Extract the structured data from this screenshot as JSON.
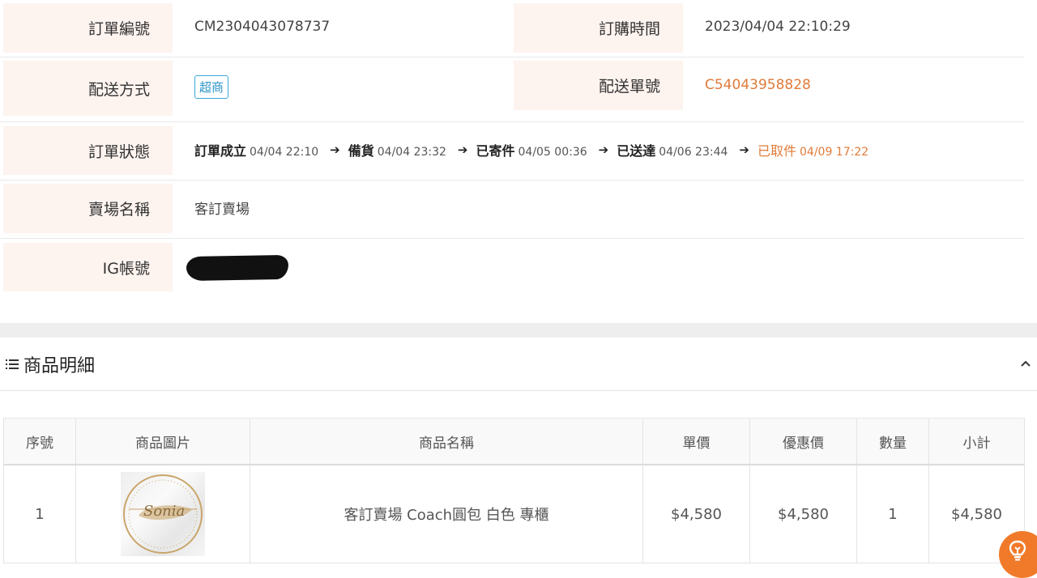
{
  "order": {
    "number_label": "訂單編號",
    "number": "CM2304043078737",
    "time_label": "訂購時間",
    "time": "2023/04/04 22:10:29",
    "shipping_label": "配送方式",
    "shipping_method": "超商",
    "tracking_label": "配送單號",
    "tracking_number": "C54043958828",
    "status_label": "訂單狀態",
    "statuses": [
      {
        "name": "訂單成立",
        "time": "04/04 22:10"
      },
      {
        "name": "備貨",
        "time": "04/04 23:32"
      },
      {
        "name": "已寄件",
        "time": "04/05 00:36"
      },
      {
        "name": "已送達",
        "time": "04/06 23:44"
      },
      {
        "name": "已取件",
        "time": "04/09 17:22"
      }
    ],
    "store_label": "賣場名稱",
    "store_name": "客訂賣場",
    "ig_label": "IG帳號"
  },
  "products": {
    "section_title": "商品明細",
    "headers": [
      "序號",
      "商品圖片",
      "商品名稱",
      "單價",
      "優惠價",
      "數量",
      "小計"
    ],
    "rows": [
      {
        "index": "1",
        "image_text": "Sonia",
        "name": "客訂賣場 Coach圓包 白色 專櫃",
        "price": "$4,580",
        "discount_price": "$4,580",
        "qty": "1",
        "subtotal": "$4,580"
      }
    ]
  },
  "colors": {
    "accent": "#e07b39",
    "label_bg": "#fdf3ef",
    "badge": "#2a93c8",
    "help_button": "#f07a2a"
  },
  "icons": {
    "section": "list-icon",
    "collapse": "chevron-up-icon",
    "help": "lightbulb-icon"
  }
}
